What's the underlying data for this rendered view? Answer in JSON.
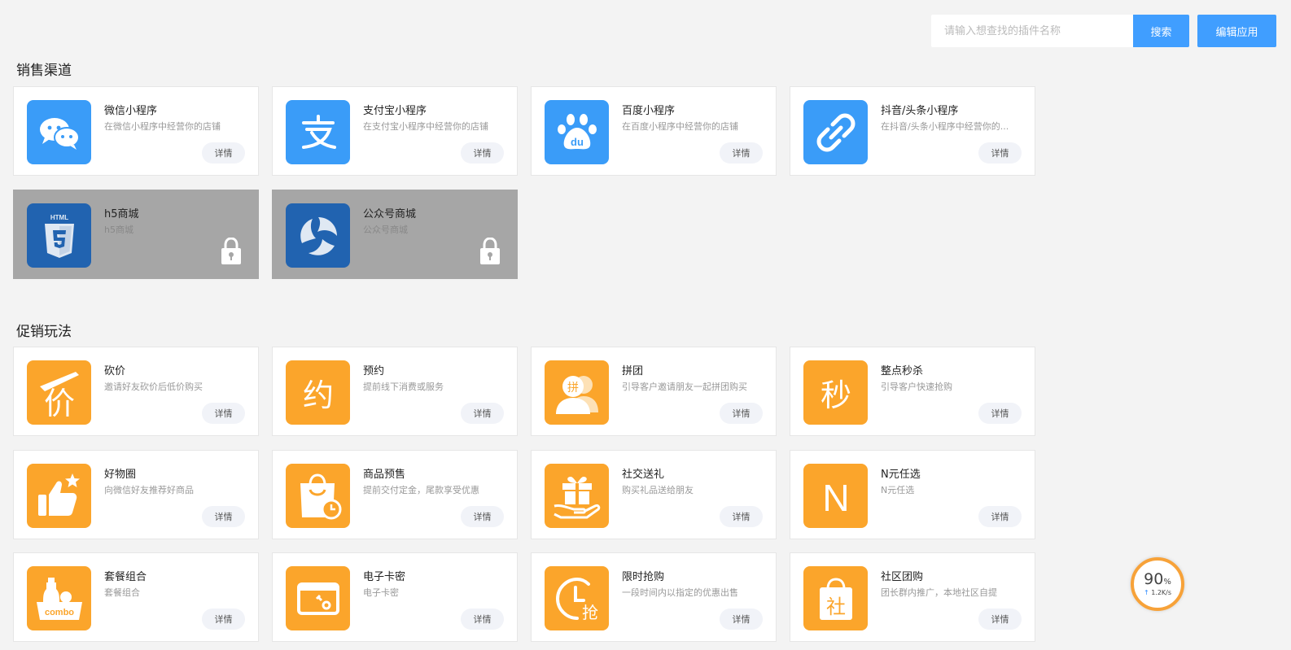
{
  "toolbar": {
    "search_placeholder": "请输入想查找的插件名称",
    "search_label": "搜索",
    "edit_label": "编辑应用"
  },
  "sections": {
    "sales": {
      "title": "销售渠道",
      "cards": [
        {
          "name": "微信小程序",
          "desc": "在微信小程序中经营你的店铺",
          "action": "详情",
          "icon": "wechat-icon"
        },
        {
          "name": "支付宝小程序",
          "desc": "在支付宝小程序中经营你的店铺",
          "action": "详情",
          "icon": "alipay-icon"
        },
        {
          "name": "百度小程序",
          "desc": "在百度小程序中经营你的店铺",
          "action": "详情",
          "icon": "baidu-icon"
        },
        {
          "name": "抖音/头条小程序",
          "desc": "在抖音/头条小程序中经营你的...",
          "action": "详情",
          "icon": "douyin-icon"
        },
        {
          "name": "h5商城",
          "desc": "h5商城",
          "locked": true,
          "icon": "html5-icon"
        },
        {
          "name": "公众号商城",
          "desc": "公众号商城",
          "locked": true,
          "icon": "official-account-icon"
        }
      ]
    },
    "promo": {
      "title": "促销玩法",
      "cards": [
        {
          "name": "砍价",
          "desc": "邀请好友砍价后低价购买",
          "action": "详情",
          "icon": "bargain-icon",
          "glyph": "价"
        },
        {
          "name": "预约",
          "desc": "提前线下消费或服务",
          "action": "详情",
          "icon": "reservation-icon",
          "glyph": "约"
        },
        {
          "name": "拼团",
          "desc": "引导客户邀请朋友一起拼团购买",
          "action": "详情",
          "icon": "group-buy-icon",
          "glyph": "拼"
        },
        {
          "name": "整点秒杀",
          "desc": "引导客户快速抢购",
          "action": "详情",
          "icon": "flash-sale-icon",
          "glyph": "秒"
        },
        {
          "name": "好物圈",
          "desc": "向微信好友推荐好商品",
          "action": "详情",
          "icon": "thumbs-up-icon"
        },
        {
          "name": "商品预售",
          "desc": "提前交付定金，尾款享受优惠",
          "action": "详情",
          "icon": "presale-bag-icon"
        },
        {
          "name": "社交送礼",
          "desc": "购买礼品送给朋友",
          "action": "详情",
          "icon": "gift-icon"
        },
        {
          "name": "N元任选",
          "desc": "N元任选",
          "action": "详情",
          "icon": "n-letter-icon",
          "glyph": "N"
        },
        {
          "name": "套餐组合",
          "desc": "套餐组合",
          "action": "详情",
          "icon": "combo-icon",
          "glyph": "combo"
        },
        {
          "name": "电子卡密",
          "desc": "电子卡密",
          "action": "详情",
          "icon": "e-card-icon"
        },
        {
          "name": "限时抢购",
          "desc": "一段时间内以指定的优惠出售",
          "action": "详情",
          "icon": "timed-sale-icon",
          "glyph": "抢"
        },
        {
          "name": "社区团购",
          "desc": "团长群内推广，本地社区自提",
          "action": "详情",
          "icon": "community-bag-icon",
          "glyph": "社"
        }
      ]
    }
  },
  "network_widget": {
    "percent": "90",
    "percent_unit": "%",
    "rate": "1.2K/s"
  },
  "colors": {
    "accent": "#409eff",
    "channel_icon": "#3a9cf8",
    "locked_icon": "#2163b0",
    "promo_icon": "#fba52b"
  }
}
